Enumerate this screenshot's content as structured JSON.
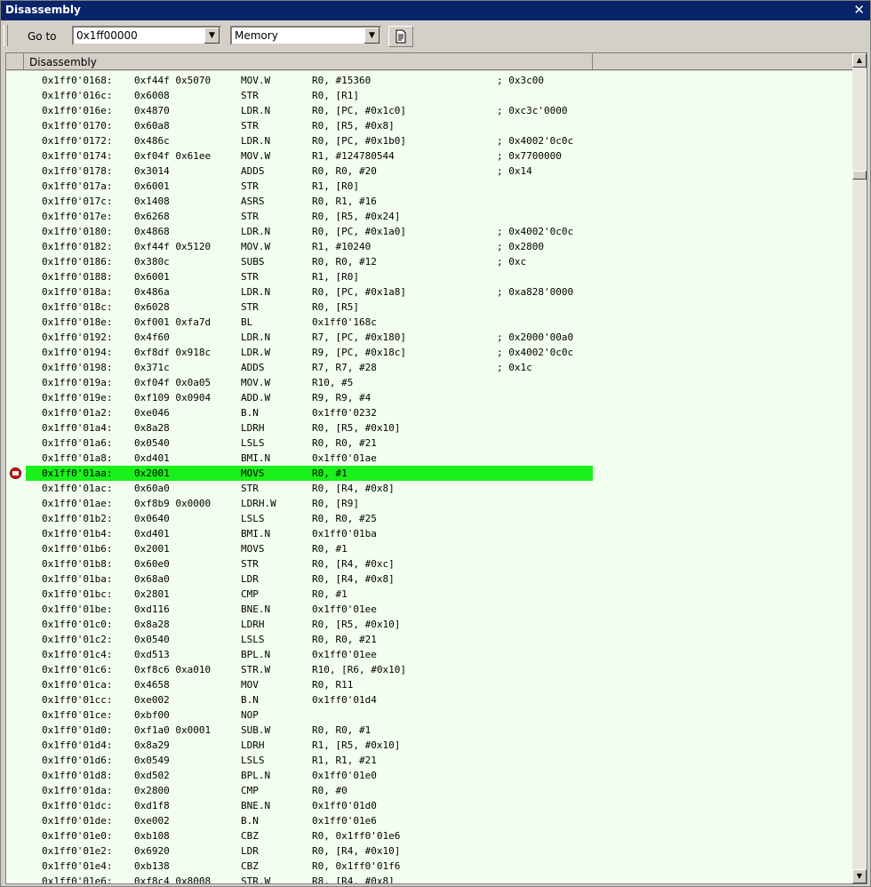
{
  "window": {
    "title": "Disassembly",
    "close_glyph": "✕"
  },
  "toolbar": {
    "goto_label": "Go to",
    "goto_value": "0x1ff00000",
    "memory_value": "Memory",
    "button_icon": "document-icon"
  },
  "columns": {
    "disassembly": "Disassembly"
  },
  "highlight_color": "#1af01a",
  "current_row_index": 26,
  "rows": [
    {
      "addr": "0x1ff0'0168:",
      "hex": "0xf44f 0x5070",
      "mn": "MOV.W",
      "ops": "R0, #15360",
      "cmt": "; 0x3c00"
    },
    {
      "addr": "0x1ff0'016c:",
      "hex": "0x6008",
      "mn": "STR",
      "ops": "R0, [R1]",
      "cmt": ""
    },
    {
      "addr": "0x1ff0'016e:",
      "hex": "0x4870",
      "mn": "LDR.N",
      "ops": "R0, [PC, #0x1c0]",
      "cmt": "; 0xc3c'0000"
    },
    {
      "addr": "0x1ff0'0170:",
      "hex": "0x60a8",
      "mn": "STR",
      "ops": "R0, [R5, #0x8]",
      "cmt": ""
    },
    {
      "addr": "0x1ff0'0172:",
      "hex": "0x486c",
      "mn": "LDR.N",
      "ops": "R0, [PC, #0x1b0]",
      "cmt": "; 0x4002'0c0c"
    },
    {
      "addr": "0x1ff0'0174:",
      "hex": "0xf04f 0x61ee",
      "mn": "MOV.W",
      "ops": "R1, #124780544",
      "cmt": "; 0x7700000"
    },
    {
      "addr": "0x1ff0'0178:",
      "hex": "0x3014",
      "mn": "ADDS",
      "ops": "R0, R0, #20",
      "cmt": "; 0x14"
    },
    {
      "addr": "0x1ff0'017a:",
      "hex": "0x6001",
      "mn": "STR",
      "ops": "R1, [R0]",
      "cmt": ""
    },
    {
      "addr": "0x1ff0'017c:",
      "hex": "0x1408",
      "mn": "ASRS",
      "ops": "R0, R1, #16",
      "cmt": ""
    },
    {
      "addr": "0x1ff0'017e:",
      "hex": "0x6268",
      "mn": "STR",
      "ops": "R0, [R5, #0x24]",
      "cmt": ""
    },
    {
      "addr": "0x1ff0'0180:",
      "hex": "0x4868",
      "mn": "LDR.N",
      "ops": "R0, [PC, #0x1a0]",
      "cmt": "; 0x4002'0c0c"
    },
    {
      "addr": "0x1ff0'0182:",
      "hex": "0xf44f 0x5120",
      "mn": "MOV.W",
      "ops": "R1, #10240",
      "cmt": "; 0x2800"
    },
    {
      "addr": "0x1ff0'0186:",
      "hex": "0x380c",
      "mn": "SUBS",
      "ops": "R0, R0, #12",
      "cmt": "; 0xc"
    },
    {
      "addr": "0x1ff0'0188:",
      "hex": "0x6001",
      "mn": "STR",
      "ops": "R1, [R0]",
      "cmt": ""
    },
    {
      "addr": "0x1ff0'018a:",
      "hex": "0x486a",
      "mn": "LDR.N",
      "ops": "R0, [PC, #0x1a8]",
      "cmt": "; 0xa828'0000"
    },
    {
      "addr": "0x1ff0'018c:",
      "hex": "0x6028",
      "mn": "STR",
      "ops": "R0, [R5]",
      "cmt": ""
    },
    {
      "addr": "0x1ff0'018e:",
      "hex": "0xf001 0xfa7d",
      "mn": "BL",
      "ops": "0x1ff0'168c",
      "cmt": ""
    },
    {
      "addr": "0x1ff0'0192:",
      "hex": "0x4f60",
      "mn": "LDR.N",
      "ops": "R7, [PC, #0x180]",
      "cmt": "; 0x2000'00a0"
    },
    {
      "addr": "0x1ff0'0194:",
      "hex": "0xf8df 0x918c",
      "mn": "LDR.W",
      "ops": "R9, [PC, #0x18c]",
      "cmt": "; 0x4002'0c0c"
    },
    {
      "addr": "0x1ff0'0198:",
      "hex": "0x371c",
      "mn": "ADDS",
      "ops": "R7, R7, #28",
      "cmt": "; 0x1c"
    },
    {
      "addr": "0x1ff0'019a:",
      "hex": "0xf04f 0x0a05",
      "mn": "MOV.W",
      "ops": "R10, #5",
      "cmt": ""
    },
    {
      "addr": "0x1ff0'019e:",
      "hex": "0xf109 0x0904",
      "mn": "ADD.W",
      "ops": "R9, R9, #4",
      "cmt": ""
    },
    {
      "addr": "0x1ff0'01a2:",
      "hex": "0xe046",
      "mn": "B.N",
      "ops": "0x1ff0'0232",
      "cmt": ""
    },
    {
      "addr": "0x1ff0'01a4:",
      "hex": "0x8a28",
      "mn": "LDRH",
      "ops": "R0, [R5, #0x10]",
      "cmt": ""
    },
    {
      "addr": "0x1ff0'01a6:",
      "hex": "0x0540",
      "mn": "LSLS",
      "ops": "R0, R0, #21",
      "cmt": ""
    },
    {
      "addr": "0x1ff0'01a8:",
      "hex": "0xd401",
      "mn": "BMI.N",
      "ops": "0x1ff0'01ae",
      "cmt": ""
    },
    {
      "addr": "0x1ff0'01aa:",
      "hex": "0x2001",
      "mn": "MOVS",
      "ops": "R0, #1",
      "cmt": ""
    },
    {
      "addr": "0x1ff0'01ac:",
      "hex": "0x60a0",
      "mn": "STR",
      "ops": "R0, [R4, #0x8]",
      "cmt": ""
    },
    {
      "addr": "0x1ff0'01ae:",
      "hex": "0xf8b9 0x0000",
      "mn": "LDRH.W",
      "ops": "R0, [R9]",
      "cmt": ""
    },
    {
      "addr": "0x1ff0'01b2:",
      "hex": "0x0640",
      "mn": "LSLS",
      "ops": "R0, R0, #25",
      "cmt": ""
    },
    {
      "addr": "0x1ff0'01b4:",
      "hex": "0xd401",
      "mn": "BMI.N",
      "ops": "0x1ff0'01ba",
      "cmt": ""
    },
    {
      "addr": "0x1ff0'01b6:",
      "hex": "0x2001",
      "mn": "MOVS",
      "ops": "R0, #1",
      "cmt": ""
    },
    {
      "addr": "0x1ff0'01b8:",
      "hex": "0x60e0",
      "mn": "STR",
      "ops": "R0, [R4, #0xc]",
      "cmt": ""
    },
    {
      "addr": "0x1ff0'01ba:",
      "hex": "0x68a0",
      "mn": "LDR",
      "ops": "R0, [R4, #0x8]",
      "cmt": ""
    },
    {
      "addr": "0x1ff0'01bc:",
      "hex": "0x2801",
      "mn": "CMP",
      "ops": "R0, #1",
      "cmt": ""
    },
    {
      "addr": "0x1ff0'01be:",
      "hex": "0xd116",
      "mn": "BNE.N",
      "ops": "0x1ff0'01ee",
      "cmt": ""
    },
    {
      "addr": "0x1ff0'01c0:",
      "hex": "0x8a28",
      "mn": "LDRH",
      "ops": "R0, [R5, #0x10]",
      "cmt": ""
    },
    {
      "addr": "0x1ff0'01c2:",
      "hex": "0x0540",
      "mn": "LSLS",
      "ops": "R0, R0, #21",
      "cmt": ""
    },
    {
      "addr": "0x1ff0'01c4:",
      "hex": "0xd513",
      "mn": "BPL.N",
      "ops": "0x1ff0'01ee",
      "cmt": ""
    },
    {
      "addr": "0x1ff0'01c6:",
      "hex": "0xf8c6 0xa010",
      "mn": "STR.W",
      "ops": "R10, [R6, #0x10]",
      "cmt": ""
    },
    {
      "addr": "0x1ff0'01ca:",
      "hex": "0x4658",
      "mn": "MOV",
      "ops": "R0, R11",
      "cmt": ""
    },
    {
      "addr": "0x1ff0'01cc:",
      "hex": "0xe002",
      "mn": "B.N",
      "ops": "0x1ff0'01d4",
      "cmt": ""
    },
    {
      "addr": "0x1ff0'01ce:",
      "hex": "0xbf00",
      "mn": "NOP",
      "ops": "",
      "cmt": ""
    },
    {
      "addr": "0x1ff0'01d0:",
      "hex": "0xf1a0 0x0001",
      "mn": "SUB.W",
      "ops": "R0, R0, #1",
      "cmt": ""
    },
    {
      "addr": "0x1ff0'01d4:",
      "hex": "0x8a29",
      "mn": "LDRH",
      "ops": "R1, [R5, #0x10]",
      "cmt": ""
    },
    {
      "addr": "0x1ff0'01d6:",
      "hex": "0x0549",
      "mn": "LSLS",
      "ops": "R1, R1, #21",
      "cmt": ""
    },
    {
      "addr": "0x1ff0'01d8:",
      "hex": "0xd502",
      "mn": "BPL.N",
      "ops": "0x1ff0'01e0",
      "cmt": ""
    },
    {
      "addr": "0x1ff0'01da:",
      "hex": "0x2800",
      "mn": "CMP",
      "ops": "R0, #0",
      "cmt": ""
    },
    {
      "addr": "0x1ff0'01dc:",
      "hex": "0xd1f8",
      "mn": "BNE.N",
      "ops": "0x1ff0'01d0",
      "cmt": ""
    },
    {
      "addr": "0x1ff0'01de:",
      "hex": "0xe002",
      "mn": "B.N",
      "ops": "0x1ff0'01e6",
      "cmt": ""
    },
    {
      "addr": "0x1ff0'01e0:",
      "hex": "0xb108",
      "mn": "CBZ",
      "ops": "R0, 0x1ff0'01e6",
      "cmt": ""
    },
    {
      "addr": "0x1ff0'01e2:",
      "hex": "0x6920",
      "mn": "LDR",
      "ops": "R0, [R4, #0x10]",
      "cmt": ""
    },
    {
      "addr": "0x1ff0'01e4:",
      "hex": "0xb138",
      "mn": "CBZ",
      "ops": "R0, 0x1ff0'01f6",
      "cmt": ""
    },
    {
      "addr": "0x1ff0'01e6:",
      "hex": "0xf8c4 0x8008",
      "mn": "STR.W",
      "ops": "R8, [R4, #0x8]",
      "cmt": ""
    }
  ]
}
